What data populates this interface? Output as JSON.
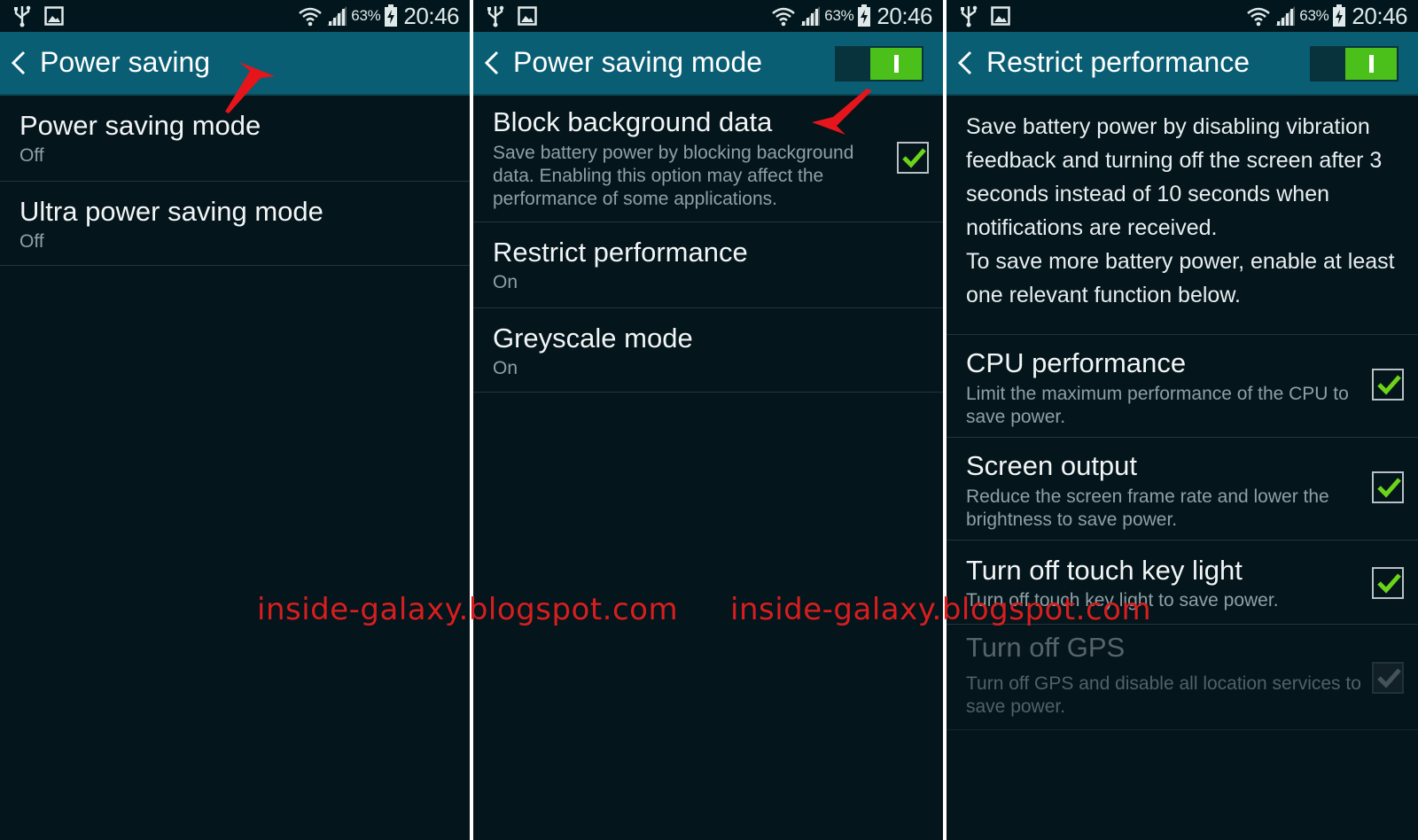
{
  "status_bar": {
    "battery_percent": "63%",
    "time": "20:46"
  },
  "panel1": {
    "title": "Power saving",
    "items": [
      {
        "title": "Power saving mode",
        "summary": "Off"
      },
      {
        "title": "Ultra power saving mode",
        "summary": "Off"
      }
    ]
  },
  "panel2": {
    "title": "Power saving mode",
    "toggle_on": true,
    "items": [
      {
        "title": "Block background data",
        "summary": "Save battery power by blocking background data. Enabling this option may affect the performance of some applications.",
        "checked": true
      },
      {
        "title": "Restrict performance",
        "summary": "On"
      },
      {
        "title": "Greyscale mode",
        "summary": "On"
      }
    ]
  },
  "panel3": {
    "title": "Restrict performance",
    "toggle_on": true,
    "description": "Save battery power by disabling vibration feedback and turning off the screen after 3 seconds instead of 10 seconds when notifications are received.\nTo save more battery power, enable at least one relevant function below.",
    "items": [
      {
        "title": "CPU performance",
        "summary": "Limit the maximum performance of the CPU to save power.",
        "checked": true,
        "enabled": true
      },
      {
        "title": "Screen output",
        "summary": "Reduce the screen frame rate and lower the brightness to save power.",
        "checked": true,
        "enabled": true
      },
      {
        "title": "Turn off touch key light",
        "summary": "Turn off touch key light to save power.",
        "checked": true,
        "enabled": true
      },
      {
        "title": "Turn off GPS",
        "summary": "Turn off GPS and disable all location services to save power.",
        "checked": true,
        "enabled": false
      }
    ]
  },
  "watermark": "inside-galaxy.blogspot.com",
  "icons": {
    "status": [
      "usb-icon",
      "gallery-icon",
      "wifi-icon",
      "signal-icon",
      "battery-charging-icon"
    ],
    "nav": "back-chevron-icon",
    "annotation": "red-arrow-icon"
  },
  "colors": {
    "appbar": "#0a5e74",
    "background": "#04151c",
    "toggle_on": "#4cc01a",
    "check": "#6cd419",
    "watermark": "#d81e1e"
  }
}
